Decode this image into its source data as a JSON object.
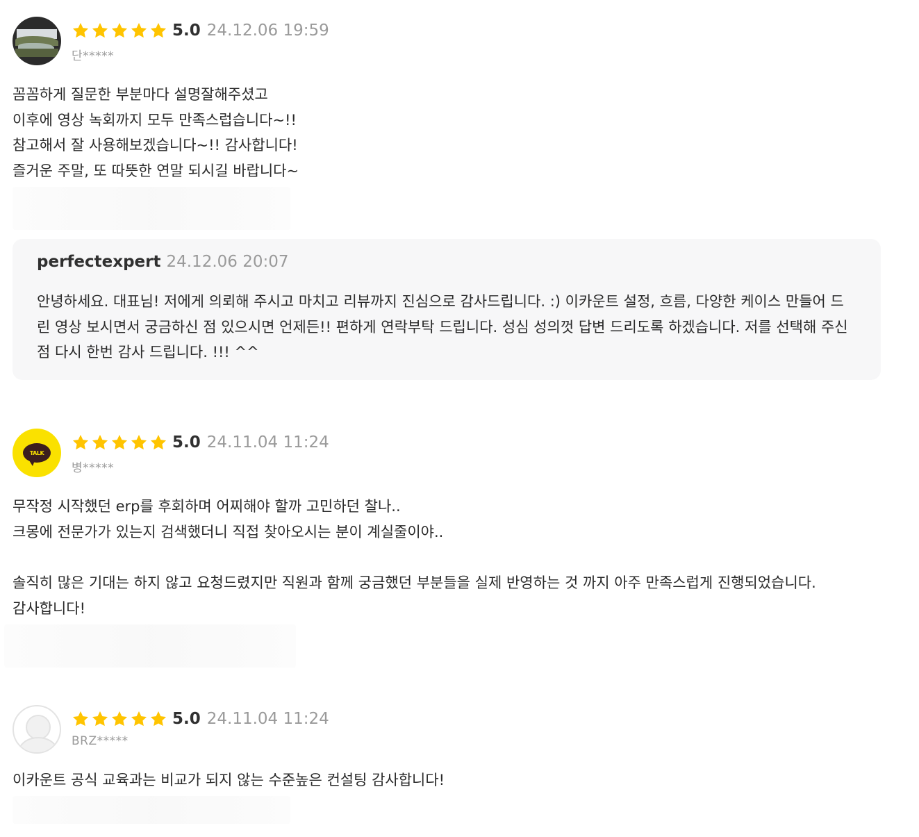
{
  "reviews": [
    {
      "avatar": "landscape-photo",
      "rating": "5.0",
      "date": "24.12.06 19:59",
      "user": "단*****",
      "body": "꼼꼼하게 질문한 부분마다 설명잘해주셨고\n이후에 영상 녹회까지 모두 만족스럽습니다~!!\n참고해서 잘 사용해보겠습니다~!! 감사합니다!\n즐거운 주말, 또 따뜻한 연말 되시길 바랍니다~"
    },
    {
      "avatar": "kakao-talk-logo",
      "avatar_text": "TALK",
      "rating": "5.0",
      "date": "24.11.04 11:24",
      "user": "병*****",
      "body": "무작정 시작했던 erp를 후회하며 어찌해야 할까 고민하던 찰나..\n크몽에 전문가가 있는지 검색했더니 직접 찾아오시는 분이 계실줄이야..\n\n솔직히 많은 기대는 하지 않고 요청드렸지만 직원과 함께 궁금했던 부분들을 실제 반영하는 것 까지 아주 만족스럽게 진행되었습니다.\n감사합니다!"
    },
    {
      "avatar": "default-user",
      "rating": "5.0",
      "date": "24.11.04 11:24",
      "user": "BRZ*****",
      "body": "이카운트 공식 교육과는 비교가 되지 않는 수준높은 컨설팅 감사합니다!"
    }
  ],
  "reply": {
    "name": "perfectexpert",
    "date": "24.12.06 20:07",
    "body": "안녕하세요. 대표님! 저에게 의뢰해 주시고 마치고 리뷰까지  진심으로 감사드립니다.   :)  이카운트 설정, 흐름, 다양한 케이스 만들어 드린 영상 보시면서 궁금하신 점 있으시면 언제든!!  편하게 연락부탁 드립니다. 성심 성의껏 답변 드리도록 하겠습니다. 저를 선택해 주신점 다시 한번 감사 드립니다. !!! ^^"
  },
  "colors": {
    "star": "#ffc400",
    "muted": "#9a9a9a",
    "reply_bg": "#f7f7f8"
  }
}
